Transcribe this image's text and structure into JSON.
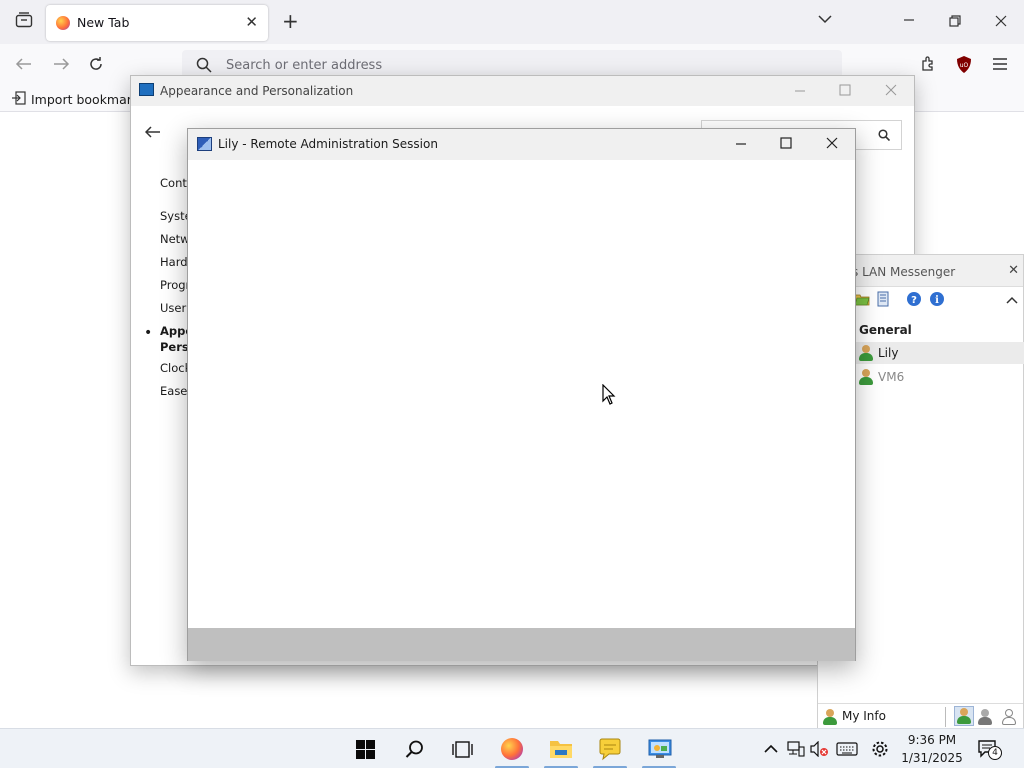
{
  "browser": {
    "tab_title": "New Tab",
    "address_placeholder": "Search or enter address",
    "bookmark_import": "Import bookmarks..."
  },
  "control_panel": {
    "title": "Appearance and Personalization",
    "sidebar": [
      {
        "label": "Contr"
      },
      {
        "label": "Syste"
      },
      {
        "label": "Netw"
      },
      {
        "label": "Hardv"
      },
      {
        "label": "Progr"
      },
      {
        "label": "User /"
      },
      {
        "label": "Appe",
        "label2": "Perso",
        "selected": true
      },
      {
        "label": "Clock"
      },
      {
        "label": "Ease c"
      }
    ]
  },
  "messenger": {
    "title": "s LAN Messenger",
    "group": "General",
    "users": [
      {
        "name": "Lily",
        "status": "online"
      },
      {
        "name": "VM6",
        "status": "offline"
      }
    ],
    "my_info": "My Info"
  },
  "remote_session": {
    "title": "Lily - Remote Administration Session"
  },
  "taskbar": {
    "time": "9:36 PM",
    "date": "1/31/2025",
    "notification_count": "4"
  },
  "colors": {
    "firefox_chrome": "#f0f0f4",
    "status_bar": "#bfbfbf",
    "taskbar": "#eef2f7",
    "accent_blue": "#0078d4"
  }
}
